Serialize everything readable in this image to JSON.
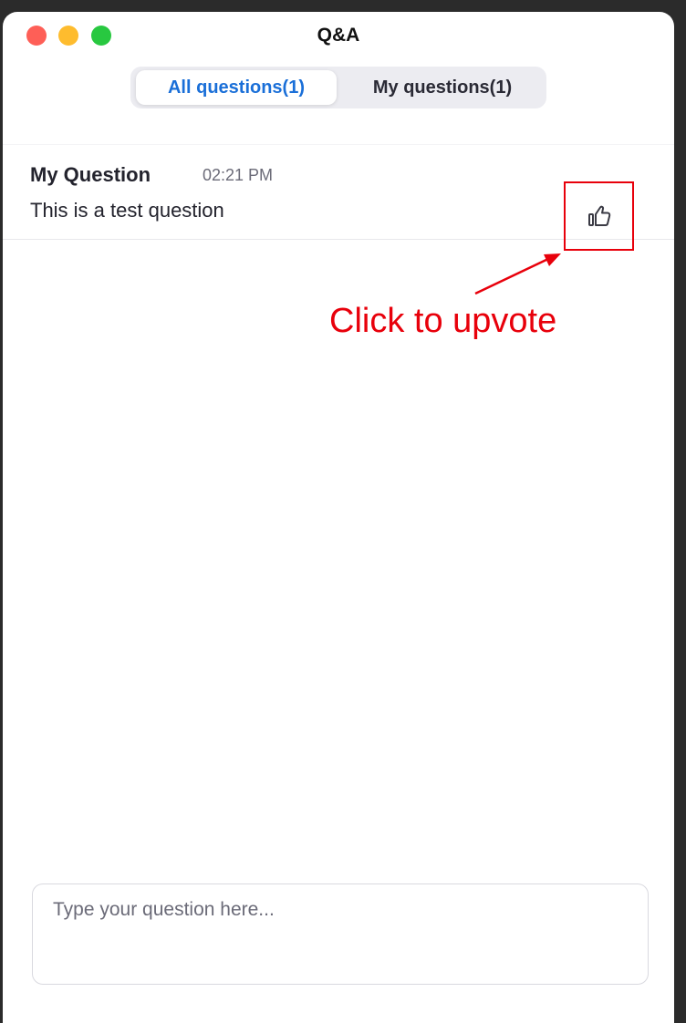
{
  "window": {
    "title": "Q&A"
  },
  "tabs": [
    {
      "label": "All questions(1)",
      "active": true
    },
    {
      "label": "My questions(1)",
      "active": false
    }
  ],
  "questions": [
    {
      "author": "My Question",
      "time": "02:21 PM",
      "text": "This is a test question",
      "upvote_icon": "thumbs-up-icon"
    }
  ],
  "annotation": {
    "text": "Click to upvote",
    "color": "#e8000b"
  },
  "composer": {
    "placeholder": "Type your question here..."
  },
  "colors": {
    "accent": "#1a6fd8",
    "close": "#fe5f57",
    "minimize": "#febc2e",
    "maximize": "#28c840"
  }
}
